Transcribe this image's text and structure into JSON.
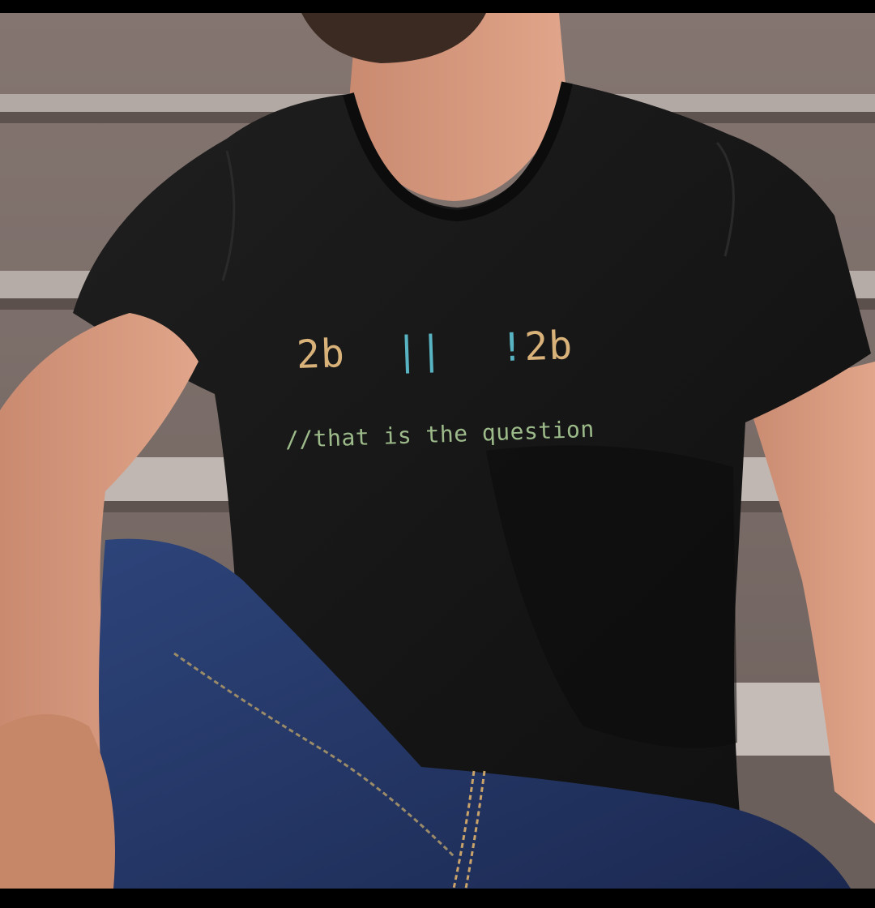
{
  "shirt_print": {
    "line1": {
      "token_a": "2b",
      "operator": "||",
      "negation": "!",
      "token_b": "2b"
    },
    "line2": "//that is the question"
  },
  "colors": {
    "token": "#d9b27a",
    "operator": "#58b4c3",
    "comment": "#9dbb8a",
    "shirt": "#181818",
    "jeans": "#22325f",
    "wall": "#8c7d76",
    "skin": "#d79a7f"
  }
}
